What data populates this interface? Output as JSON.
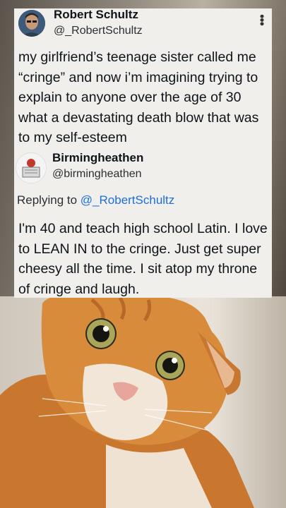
{
  "tweet": {
    "author_name": "Robert Schultz",
    "author_handle": "@_RobertSchultz",
    "more_icon": "more-vertical-icon",
    "text": "my girlfriend’s teenage sister called me “cringe” and now i’m imagining trying to explain to anyone over the age of 30 what a devastating death blow that was to my self-esteem"
  },
  "reply": {
    "author_name": "Birmingheathen",
    "author_handle": "@birmingheathen",
    "replying_to_label": "Replying to",
    "replying_to_handle": "@_RobertSchultz",
    "text": "I'm 40 and teach high school Latin. I love to LEAN IN to the cringe. Just get super cheesy all the time. I sit atop my throne of cringe and laugh."
  },
  "colors": {
    "card_bg": "#f1efec",
    "mention": "#1d6fd6",
    "cat_fur": "#d9893a"
  }
}
